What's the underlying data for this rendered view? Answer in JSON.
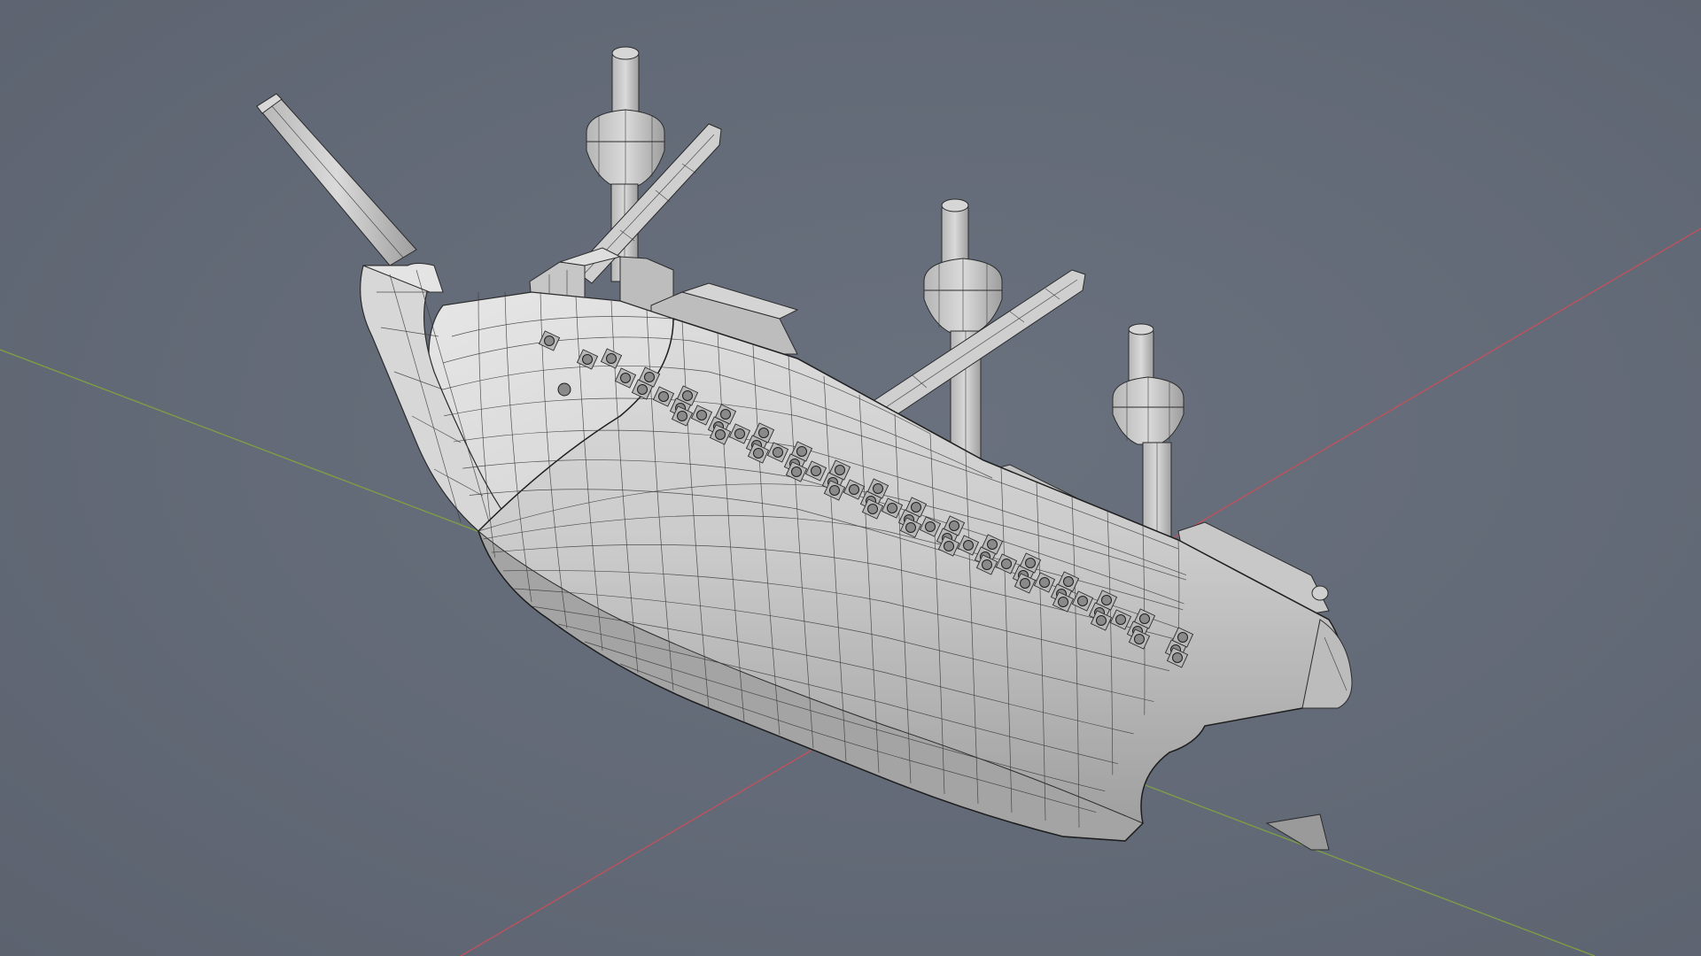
{
  "app": {
    "view": "3D Viewport",
    "shading": "solid-wireframe-overlay"
  },
  "colors": {
    "background": "#636a77",
    "mesh_fill": "#c9c9c9",
    "mesh_shade": "#a9a9a9",
    "wireframe": "#2b2b2b",
    "x_axis": "#c4505c",
    "y_axis": "#7fa043"
  },
  "scene": {
    "object": "ship",
    "object_type": "galleon mesh",
    "masts": 3,
    "axes_visible": [
      "x-axis",
      "y-axis"
    ]
  }
}
